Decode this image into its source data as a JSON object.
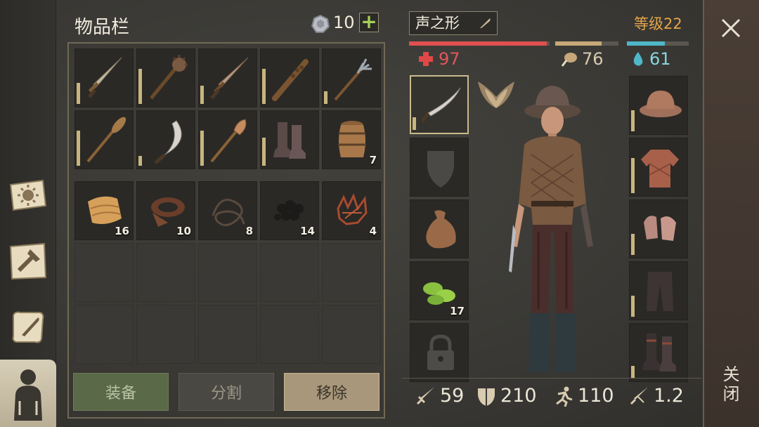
{
  "inventory": {
    "title": "物品栏",
    "coins": "10",
    "add_label": "+"
  },
  "inventory_slots": [
    {
      "icon": "sword-icon",
      "count": ""
    },
    {
      "icon": "mace-icon",
      "count": ""
    },
    {
      "icon": "long-sword-icon",
      "count": ""
    },
    {
      "icon": "club-icon",
      "count": ""
    },
    {
      "icon": "pitchfork-icon",
      "count": ""
    },
    {
      "icon": "oar-icon",
      "count": ""
    },
    {
      "icon": "sickle-icon",
      "count": ""
    },
    {
      "icon": "shovel-icon",
      "count": ""
    },
    {
      "icon": "boots-icon",
      "count": ""
    },
    {
      "icon": "barrel-icon",
      "count": "7"
    },
    {
      "icon": "cloth-icon",
      "count": "16"
    },
    {
      "icon": "leather-icon",
      "count": "10"
    },
    {
      "icon": "rope-icon",
      "count": "8"
    },
    {
      "icon": "coal-icon",
      "count": "14"
    },
    {
      "icon": "scrap-icon",
      "count": "4"
    }
  ],
  "actions": {
    "equip": "装备",
    "split": "分割",
    "remove": "移除"
  },
  "character": {
    "name": "声之形",
    "level": "等级22",
    "health": "97",
    "food": "76",
    "water": "61",
    "attack": "59",
    "defense": "210",
    "speed": "110",
    "weight": "1.2"
  },
  "equip_slots": {
    "weapon_count": "",
    "food_count": "17"
  },
  "close": {
    "label": "关闭"
  },
  "colors": {
    "health": "#e04848",
    "food": "#c7a878",
    "water": "#4fb7c8",
    "level": "#e3a64a"
  }
}
